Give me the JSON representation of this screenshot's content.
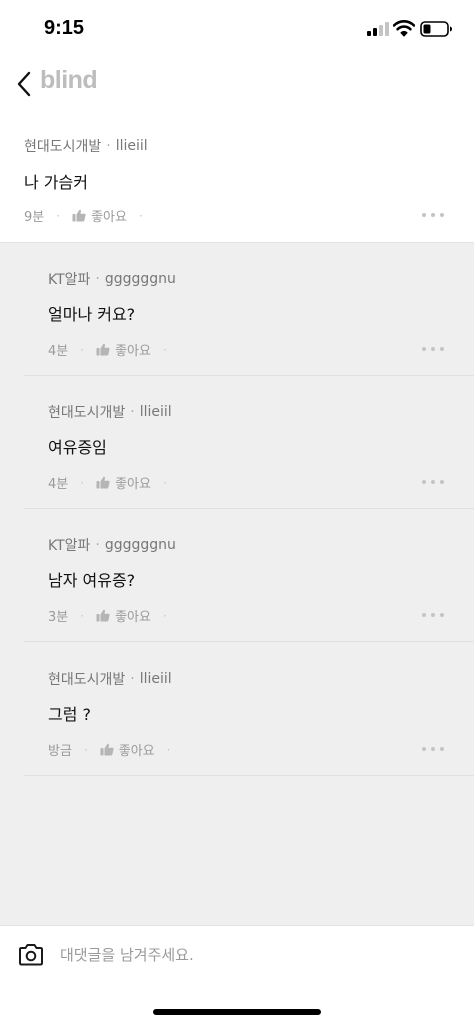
{
  "status_bar": {
    "time": "9:15"
  },
  "nav": {
    "brand": "blind"
  },
  "parent_comment": {
    "company": "현대도시개발",
    "username": "llieiil",
    "text": "나 가슴커",
    "time": "9분",
    "like_label": "좋아요"
  },
  "replies": [
    {
      "company": "KT알파",
      "username": "ggggggnu",
      "text": "얼마나 커요?",
      "time": "4분",
      "like_label": "좋아요"
    },
    {
      "company": "현대도시개발",
      "username": "llieiil",
      "text": "여유증임",
      "time": "4분",
      "like_label": "좋아요"
    },
    {
      "company": "KT알파",
      "username": "ggggggnu",
      "text": "남자 여유증?",
      "time": "3분",
      "like_label": "좋아요"
    },
    {
      "company": "현대도시개발",
      "username": "llieiil",
      "text": "그럼 ?",
      "time": "방금",
      "like_label": "좋아요"
    }
  ],
  "comment_bar": {
    "placeholder": "대댓글을 남겨주세요."
  },
  "icons": {
    "back": "chevron-left-icon",
    "like": "thumbs-up-icon",
    "more": "more-horizontal-icon",
    "camera": "camera-icon"
  },
  "colors": {
    "brand": "#bdbdbd",
    "thread_background": "#efefef",
    "muted_text": "#9a9a9a"
  }
}
